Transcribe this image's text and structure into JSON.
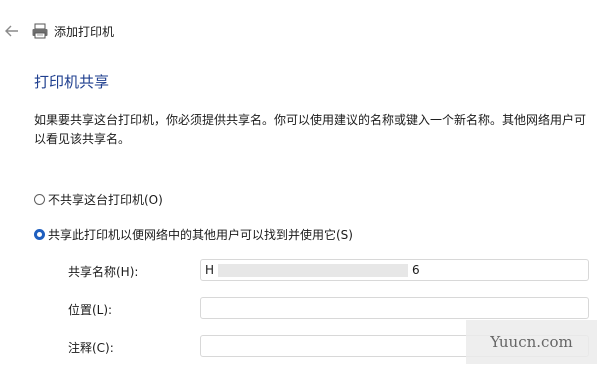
{
  "header": {
    "back_icon": "arrow-left-icon",
    "printer_icon": "printer-icon",
    "title": "添加打印机"
  },
  "section": {
    "heading": "打印机共享",
    "description": "如果要共享这台打印机，你必须提供共享名。你可以使用建议的名称或键入一个新名称。其他网络用户可以看见该共享名。"
  },
  "options": {
    "no_share": {
      "label": "不共享这台打印机(O)",
      "selected": false
    },
    "share": {
      "label": "共享此打印机以便网络中的其他用户可以找到并使用它(S)",
      "selected": true
    }
  },
  "fields": {
    "share_name": {
      "label": "共享名称(H):",
      "value_prefix": "H",
      "value_suffix": "6",
      "redacted": true
    },
    "location": {
      "label": "位置(L):",
      "value": ""
    },
    "comment": {
      "label": "注释(C):",
      "value": ""
    }
  },
  "colors": {
    "accent": "#1f5fbf",
    "heading": "#1f3f8f"
  },
  "watermark": {
    "text": "Yuucn.com"
  }
}
